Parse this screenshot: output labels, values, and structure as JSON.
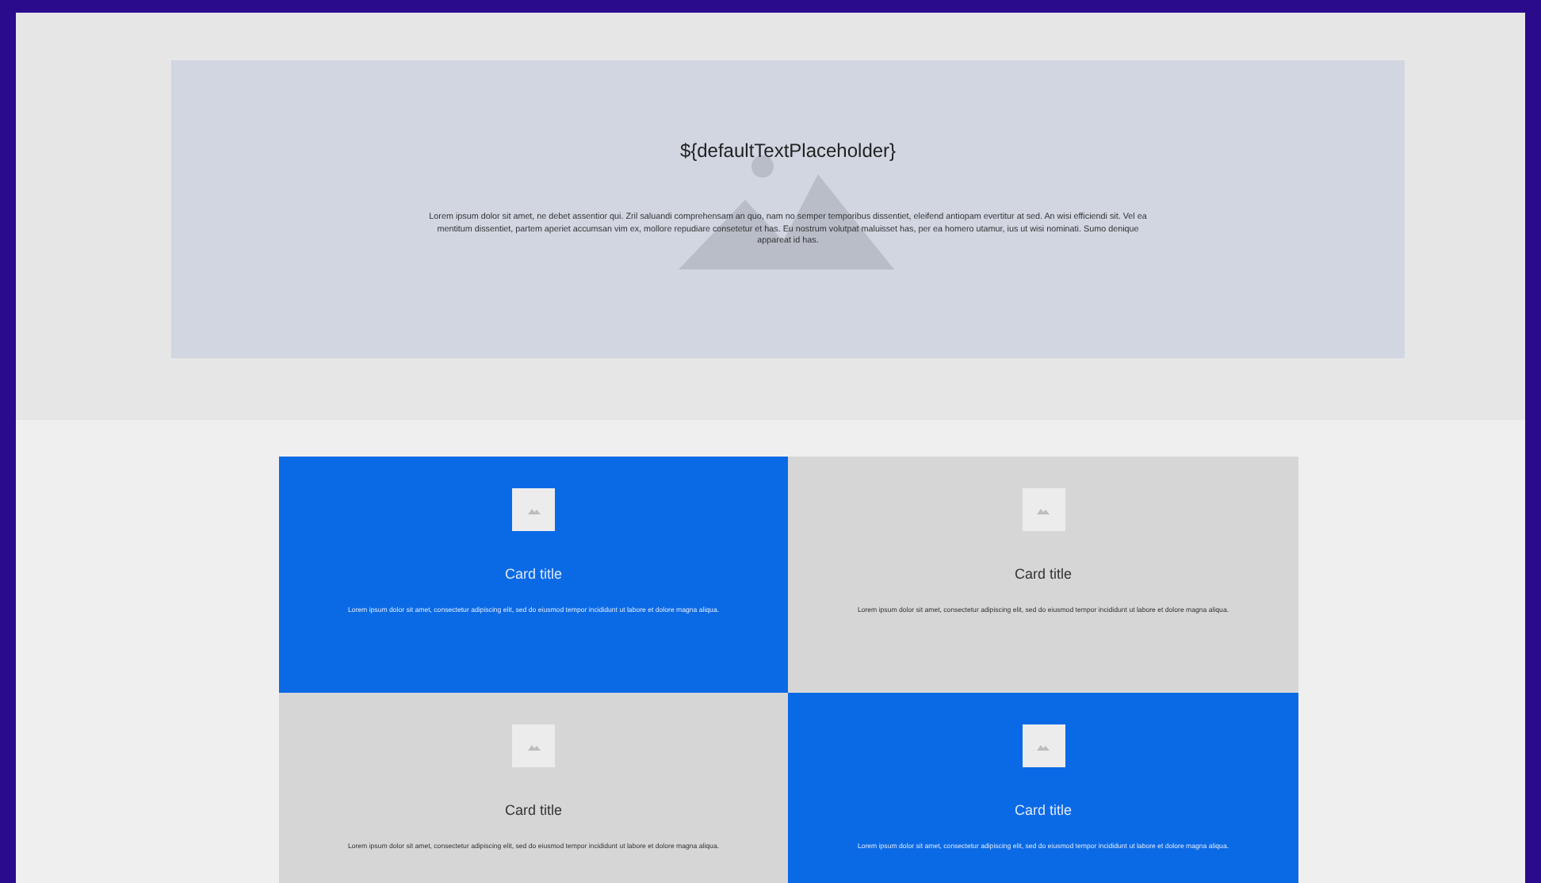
{
  "hero": {
    "title": "${defaultTextPlaceholder}",
    "text": "Lorem ipsum dolor sit amet, ne debet assentior qui. Zril saluandi comprehensam an quo, nam no semper temporibus dissentiet, eleifend antiopam evertitur at sed. An wisi efficiendi sit. Vel ea mentitum dissentiet, partem aperiet accumsan vim ex, mollore repudiare consetetur et has. Eu nostrum volutpat maluisset has, per ea homero utamur, ius ut wisi nominati. Sumo denique appareat id has."
  },
  "cards": [
    {
      "kind": "accent",
      "title": "Card title",
      "text": "Lorem ipsum dolor sit amet, consectetur adipiscing elit, sed do eiusmod tempor incididunt ut labore et dolore magna aliqua."
    },
    {
      "kind": "plain",
      "title": "Card title",
      "text": "Lorem ipsum dolor sit amet, consectetur adipiscing elit, sed do eiusmod tempor incididunt ut labore et dolore magna aliqua."
    },
    {
      "kind": "plain",
      "title": "Card title",
      "text": "Lorem ipsum dolor sit amet, consectetur adipiscing elit, sed do eiusmod tempor incididunt ut labore et dolore magna aliqua."
    },
    {
      "kind": "accent",
      "title": "Card title",
      "text": "Lorem ipsum dolor sit amet, consectetur adipiscing elit, sed do eiusmod tempor incididunt ut labore et dolore magna aliqua."
    }
  ]
}
